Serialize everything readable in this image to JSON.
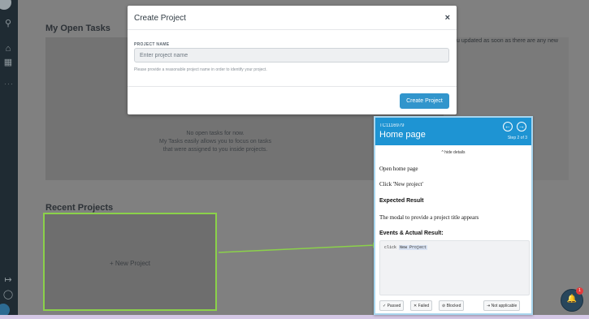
{
  "dashboard": {
    "my_open_tasks_title": "My Open Tasks",
    "empty_title": "No open tasks for now.",
    "empty_line1": "My Tasks easily allows you to focus on tasks",
    "empty_line2": "that were assigned to you inside projects.",
    "updated_line1": "u updated as soon as there are any new",
    "updated_line2": "",
    "recent_projects_title": "Recent Projects",
    "new_project_label": "+ New Project"
  },
  "modal": {
    "title": "Create Project",
    "close_glyph": "×",
    "field_label": "PROJECT NAME",
    "field_placeholder": "Enter project name",
    "field_value": "",
    "help_text": "Please provide a reasonable project name in order to identify your project.",
    "submit_label": "Create Project"
  },
  "test_case": {
    "id": "TC1116979",
    "name": "Home page",
    "prev_glyph": "←",
    "next_glyph": "→",
    "step_text": "Step 2 of 3",
    "hide_details": "^ hide details",
    "step_line1": "Open home page",
    "step_line2": "Click 'New project'",
    "expected_heading": "Expected Result",
    "expected_text": "The modal to provide a project title appears",
    "events_heading": "Events & Actual Result:",
    "event_action": "click",
    "event_target": "New Project",
    "buttons": {
      "passed": "✓ Passed",
      "failed": "✕ Failed",
      "blocked": "⊘ Blocked",
      "not_applicable": "⇥ Not applicable"
    }
  },
  "notifications": {
    "count": "1",
    "bell_icon": "bell-icon"
  },
  "colors": {
    "accent": "#1e94d3",
    "button_blue": "#3195cc",
    "highlight_green": "#8bd14a",
    "sidebar": "#1f2b33"
  }
}
